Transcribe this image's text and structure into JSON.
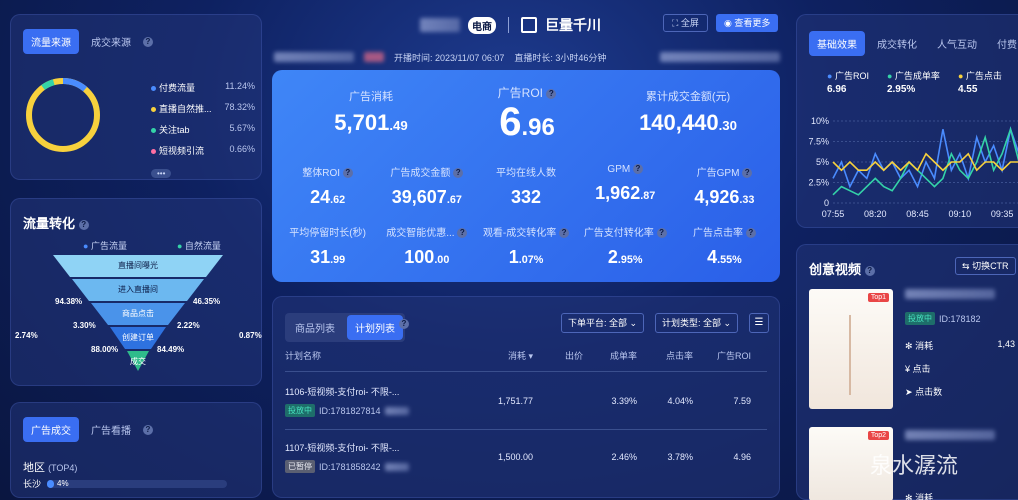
{
  "header": {
    "brand_suffix": "电商",
    "brand_name": "巨量千川",
    "fullscreen_label": "全屏",
    "view_more_label": "查看更多",
    "start_time": "开播时间: 2023/11/07 06:07",
    "duration": "直播时长: 3小时46分钟"
  },
  "source_panel": {
    "tabs": [
      "流量来源",
      "成交来源"
    ],
    "items": [
      {
        "label": "付费流量",
        "value": "11.24%",
        "color": "#4a8cff"
      },
      {
        "label": "直播自然推...",
        "value": "78.32%",
        "color": "#f7d13d"
      },
      {
        "label": "关注tab",
        "value": "5.67%",
        "color": "#34d3a8"
      },
      {
        "label": "短视频引流",
        "value": "0.66%",
        "color": "#ff6fa3"
      }
    ],
    "more": "•••"
  },
  "conversion": {
    "title": "流量转化",
    "legend": [
      "广告流量",
      "自然流量"
    ],
    "stages": [
      "直播间曝光",
      "进入直播间",
      "商品点击",
      "创建订单",
      "成交"
    ],
    "left_values": [
      "94.38%",
      "3.30%",
      "88.00%"
    ],
    "right_values": [
      "46.35%",
      "2.22%",
      "84.49%"
    ],
    "side_left": "2.74%",
    "side_right": "0.87%"
  },
  "deal_panel": {
    "tabs": [
      "广告成交",
      "广告看播"
    ],
    "region_label": "地区",
    "region_sub": "(TOP4)",
    "city": "长沙",
    "city_value": "4%"
  },
  "kpi": {
    "ad_spend": {
      "label": "广告消耗",
      "int": "5,701",
      "dec": ".49"
    },
    "roi": {
      "label": "广告ROI",
      "int": "6",
      "dec": ".96"
    },
    "gmv": {
      "label": "累计成交金额(元)",
      "int": "140,440",
      "dec": ".30"
    },
    "row2": [
      {
        "label": "整体ROI",
        "int": "24",
        "dec": ".62",
        "help": true
      },
      {
        "label": "广告成交金额",
        "int": "39,607",
        "dec": ".67",
        "help": true
      },
      {
        "label": "平均在线人数",
        "int": "332",
        "dec": "",
        "help": false
      },
      {
        "label": "GPM",
        "int": "1,962",
        "dec": ".87",
        "help": true
      },
      {
        "label": "广告GPM",
        "int": "4,926",
        "dec": ".33",
        "help": true
      }
    ],
    "row3": [
      {
        "label": "平均停留时长(秒)",
        "int": "31",
        "dec": ".99",
        "help": false
      },
      {
        "label": "成交智能优惠...",
        "int": "100",
        "dec": ".00",
        "help": true
      },
      {
        "label": "观看-成交转化率",
        "int": "1",
        "dec": ".07%",
        "help": true
      },
      {
        "label": "广告支付转化率",
        "int": "2",
        "dec": ".95%",
        "help": true
      },
      {
        "label": "广告点击率",
        "int": "4",
        "dec": ".55%",
        "help": true
      }
    ]
  },
  "plan_table": {
    "tabs": [
      "商品列表",
      "计划列表"
    ],
    "platform_filter": "下单平台: 全部",
    "type_filter": "计划类型: 全部",
    "columns": [
      "计划名称",
      "消耗",
      "出价",
      "成单率",
      "点击率",
      "广告ROI"
    ],
    "rows": [
      {
        "name": "1106-短视频-支付roi- 不限-...",
        "status": "投放中",
        "id": "ID:1781827814",
        "spend": "1,751.77",
        "bid": "",
        "order_rate": "3.39%",
        "ctr": "4.04%",
        "roi": "7.59"
      },
      {
        "name": "1107-短视频-支付roi- 不限-...",
        "status": "已暂停",
        "id": "ID:1781858242",
        "spend": "1,500.00",
        "bid": "",
        "order_rate": "2.46%",
        "ctr": "3.78%",
        "roi": "4.96"
      }
    ]
  },
  "basic_effect": {
    "tabs": [
      "基础效果",
      "成交转化",
      "人气互动",
      "付费占比"
    ],
    "legend": [
      {
        "label": "广告ROI",
        "value": "6.96",
        "color": "#4a8cff"
      },
      {
        "label": "广告成单率",
        "value": "2.95%",
        "color": "#34d3a8"
      },
      {
        "label": "广告点击",
        "value": "4.55",
        "color": "#f7d13d"
      }
    ]
  },
  "chart_data": {
    "type": "line",
    "x": [
      "07:55",
      "08:00",
      "08:05",
      "08:10",
      "08:15",
      "08:20",
      "08:25",
      "08:30",
      "08:35",
      "08:40",
      "08:45",
      "08:50",
      "08:55",
      "09:00",
      "09:05",
      "09:10",
      "09:15",
      "09:20",
      "09:25",
      "09:30",
      "09:35",
      "09:40",
      "09:45"
    ],
    "x_ticks": [
      "07:55",
      "08:20",
      "08:45",
      "09:10",
      "09:35"
    ],
    "y_ticks": [
      "10%",
      "7.5%",
      "5%",
      "2.5%",
      "0"
    ],
    "ylim": [
      0,
      10
    ],
    "series": [
      {
        "name": "广告ROI",
        "color": "#4a8cff",
        "values": [
          3,
          5,
          2,
          4,
          3,
          6,
          4,
          5,
          3,
          4,
          2,
          5,
          3,
          9,
          4,
          6,
          3,
          8,
          5,
          7,
          4,
          9,
          6
        ]
      },
      {
        "name": "广告成单率",
        "color": "#34d3a8",
        "values": [
          1,
          2,
          1.5,
          1,
          2,
          3,
          2,
          1.5,
          3,
          5,
          4,
          3,
          2,
          3,
          6,
          4,
          3,
          5,
          8,
          4,
          6,
          9,
          5
        ]
      },
      {
        "name": "广告点击",
        "color": "#f7d13d",
        "values": [
          5,
          4,
          5,
          4,
          4,
          5,
          4,
          5,
          4,
          5,
          4,
          6,
          5,
          4,
          5,
          5,
          6,
          4,
          5,
          5,
          4,
          5,
          5
        ]
      }
    ]
  },
  "creative": {
    "title": "创意视频",
    "switch_label": "切换CTR",
    "items": [
      {
        "rank": "Top1",
        "status": "投放中",
        "id": "ID:178182",
        "m1": "消耗",
        "m1v": "1,43",
        "m2": "点击",
        "m3": "点击数"
      },
      {
        "rank": "Top2",
        "status": "",
        "id": "",
        "m1": "消耗",
        "m1v": "",
        "m2": "",
        "m3": ""
      }
    ]
  },
  "watermark": "泉水潺流"
}
